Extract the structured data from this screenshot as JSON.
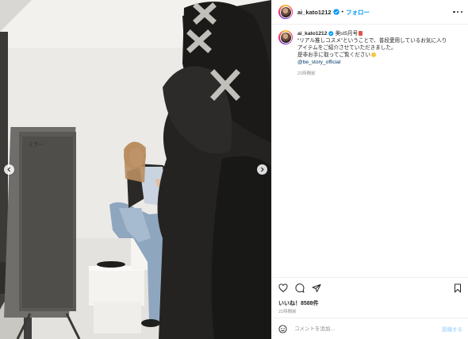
{
  "post": {
    "username": "ai_kato1212",
    "header_separator": "•",
    "follow_label": "フォロー",
    "caption": {
      "username": "ai_kato1212",
      "line1_text": "美st5月号",
      "line2": "“リアル推しコスメ”ということで、普段愛用しているお気に入り",
      "line3": "アイテムをご紹介させていただきました。",
      "line4_text": "是非お手に取ってご覧ください",
      "mention": "@be_story_official",
      "time": "21時間前"
    },
    "likes": "いいね！8588件",
    "time": "21時間前",
    "comment_placeholder": "コメントを追加...",
    "post_button_label": "投稿する",
    "photo_mirror_text": "ミラー"
  },
  "colors": {
    "accent_blue": "#0095f6",
    "verified_blue": "#0095f6",
    "muted_text": "#8e8e8e",
    "disabled_post": "#b3dbff"
  },
  "icons": {
    "header_more": "more-horizontal-icon",
    "like": "heart-icon",
    "comment": "comment-icon",
    "share": "paper-plane-icon",
    "save": "bookmark-icon",
    "emoji": "smiley-icon",
    "prev": "chevron-left-icon",
    "next": "chevron-right-icon",
    "verified": "verified-badge-icon"
  }
}
